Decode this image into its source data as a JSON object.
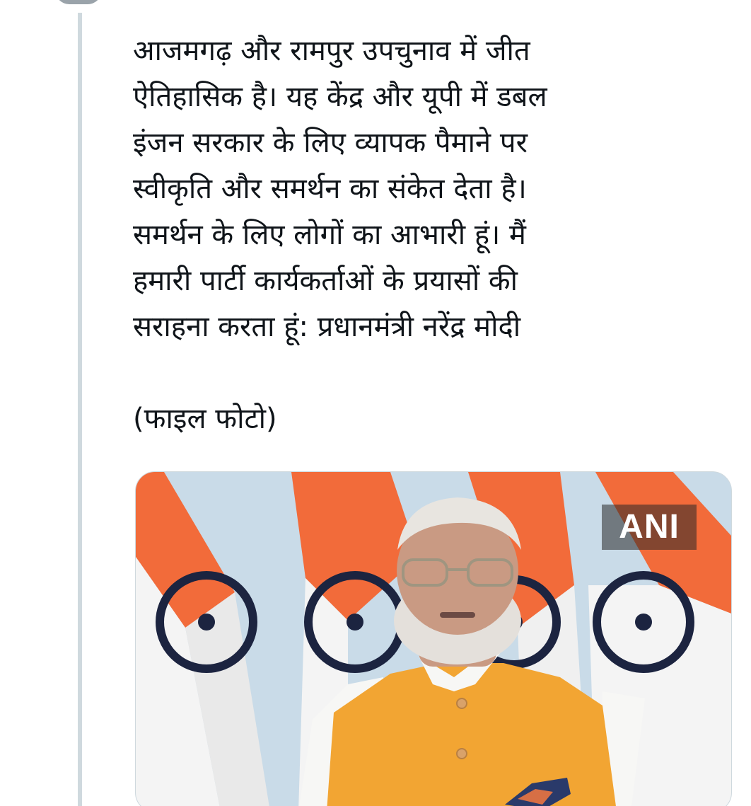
{
  "tweet": {
    "text": "आजमगढ़ और रामपुर उपचुनाव में जीत\nऐतिहासिक है। यह केंद्र और यूपी में डबल\nइंजन सरकार के लिए व्यापक पैमाने पर\nस्वीकृति और समर्थन का संकेत देता है।\nसमर्थन के लिए लोगों का आभारी हूं। मैं\nहमारी पार्टी कार्यकर्ताओं के प्रयासों की\nसराहना करता हूं: प्रधानमंत्री नरेंद्र मोदी\n\n(फाइल फोटो)"
  },
  "media": {
    "watermark": "ANI",
    "colors": {
      "saffron": "#f26b3a",
      "white": "#f4f4f4",
      "chakra_navy": "#1c2440",
      "vest_orange": "#f2a533",
      "background": "#c9dbe8"
    }
  },
  "colors": {
    "text": "#0f1419",
    "thread_line": "#cfd9de",
    "card_border": "#cfd9de"
  }
}
